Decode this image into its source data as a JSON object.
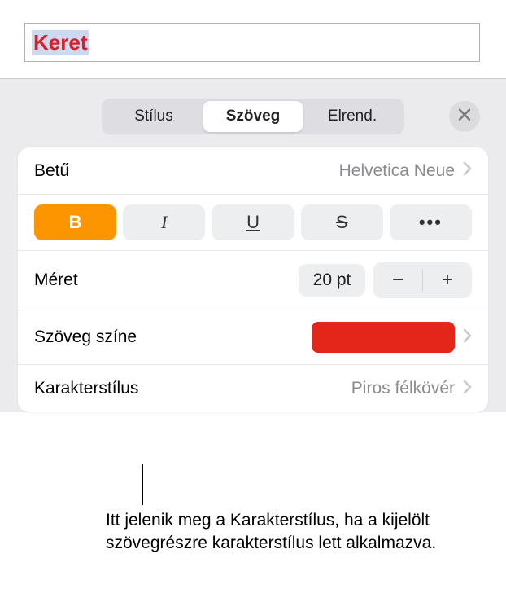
{
  "textFrame": {
    "content": "Keret"
  },
  "tabs": {
    "items": [
      "Stílus",
      "Szöveg",
      "Elrend."
    ],
    "activeIndex": 1
  },
  "font": {
    "label": "Betű",
    "value": "Helvetica Neue"
  },
  "styleButtons": {
    "bold": "B",
    "italic": "I",
    "underline": "U",
    "strike": "S",
    "more": "•••"
  },
  "size": {
    "label": "Méret",
    "value": "20 pt",
    "minus": "−",
    "plus": "+"
  },
  "textColor": {
    "label": "Szöveg színe",
    "color": "#e32619"
  },
  "charStyle": {
    "label": "Karakterstílus",
    "value": "Piros félkövér"
  },
  "callout": "Itt jelenik meg a Karakterstílus, ha a kijelölt szövegrészre karakterstílus lett alkalmazva."
}
